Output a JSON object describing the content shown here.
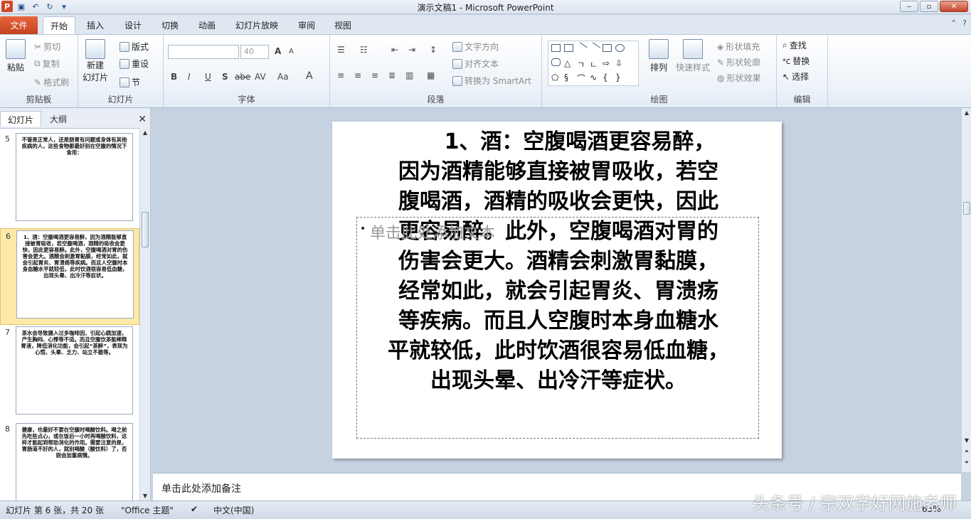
{
  "window": {
    "title": "演示文稿1  -  Microsoft PowerPoint",
    "app_icon_letter": "P",
    "controls": [
      "‒",
      "▫",
      "✕"
    ]
  },
  "tabs": [
    "文件",
    "开始",
    "插入",
    "设计",
    "切换",
    "动画",
    "幻灯片放映",
    "审阅",
    "视图"
  ],
  "active_tab": "开始",
  "ribbon": {
    "clipboard": {
      "paste": "粘贴",
      "cut": "剪切",
      "copy": "复制",
      "format_painter": "格式刷",
      "label": "剪贴板"
    },
    "slides": {
      "new_slide_1": "新建",
      "new_slide_2": "幻灯片",
      "layout": "版式",
      "reset": "重设",
      "section": "节",
      "label": "幻灯片"
    },
    "font": {
      "font_size": "40",
      "bold": "B",
      "italic": "I",
      "underline": "U",
      "shadow": "S",
      "strike": "abe",
      "spacing": "AV",
      "case": "Aa",
      "color": "A",
      "grow": "A",
      "shrink": "A",
      "label": "字体"
    },
    "paragraph": {
      "text_direction": "文字方向",
      "align_text": "对齐文本",
      "smartart": "转换为 SmartArt",
      "label": "段落"
    },
    "drawing": {
      "arrange": "排列",
      "quick_styles": "快速样式",
      "shape_fill": "形状填充",
      "shape_outline": "形状轮廓",
      "shape_effects": "形状效果",
      "label": "绘图"
    },
    "editing": {
      "find": "查找",
      "replace": "替换",
      "select": "选择",
      "label": "编辑"
    }
  },
  "panel": {
    "tab_slides": "幻灯片",
    "tab_outline": "大纲",
    "thumbnails": [
      {
        "num": "5",
        "text": "不管是正常人，还是肠胃有问题或身体有其他疾病的人，这些食物都最好别在空腹的情况下食用："
      },
      {
        "num": "6",
        "text": "1、酒：空腹喝酒更容易醉，因为酒精能够直接被胃吸收，若空腹喝酒，酒精的吸收会更快，因此更容易醉。此外，空腹喝酒对胃的伤害会更大。酒精会刺激胃黏膜，经常如此，就会引起胃炎、胃溃疡等疾病。而且人空腹时本身血糖水平就较低，此时饮酒很容易低血糖，出现头晕、出冷汗等症状。"
      },
      {
        "num": "7",
        "text": "茶水会导致摄入过多咖啡因，引起心跳加速，产生胸闷、心悸等不适。而且空腹饮茶能稀释胃液，降低消化功能，会引起“茶醉”，表现为心慌、头晕、乏力、站立不稳等。"
      },
      {
        "num": "8",
        "text": "健康，也最好不要在空腹时喝酸饮料。喝之前先吃些点心，或在饭后一小时再喝酸饮料，这样才能起到帮助消化的作用。需要注意的是，胃肠道不好的人，就别喝酸（酸饮料）了，否则会加重病情。"
      }
    ]
  },
  "slide": {
    "lines": [
      "1、酒：空腹喝酒更容易醉，",
      "因为酒精能够直接被胃吸收，若空",
      "腹喝酒，酒精的吸收会更快，因此",
      "更容易醉。此外，空腹喝酒对胃的",
      "伤害会更大。酒精会刺激胃黏膜，",
      "经常如此，就会引起胃炎、胃溃疡",
      "等疾病。而且人空腹时本身血糖水",
      "平就较低，此时饮酒很容易低血糖，",
      "出现头晕、出冷汗等症状。"
    ],
    "placeholder_hint": "单击此处添加文本",
    "placeholder_bullet": "•"
  },
  "notes": {
    "placeholder": "单击此处添加备注"
  },
  "status": {
    "slide_info": "幻灯片 第 6 张，共 20 张",
    "theme": "\"Office 主题\"",
    "language": "中文(中国)",
    "zoom": "65%"
  },
  "watermark": "头条号 / 宗双学好网施老师"
}
